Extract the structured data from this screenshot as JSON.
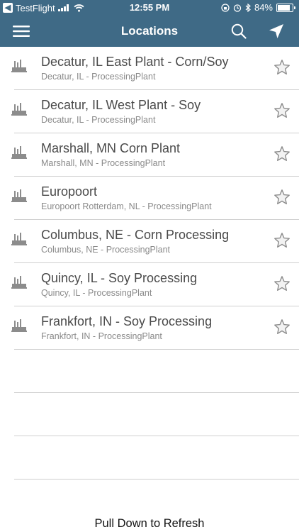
{
  "status_bar": {
    "carrier": "TestFlight",
    "time": "12:55 PM",
    "battery": "84%"
  },
  "nav": {
    "title": "Locations",
    "menu_icon": "hamburger-menu-icon",
    "search_icon": "search-icon",
    "location_icon": "location-arrow-icon"
  },
  "locations": [
    {
      "name": "Decatur, IL East Plant - Corn/Soy",
      "subtitle": "Decatur, IL - ProcessingPlant"
    },
    {
      "name": "Decatur, IL West Plant - Soy",
      "subtitle": "Decatur, IL - ProcessingPlant"
    },
    {
      "name": "Marshall, MN Corn Plant",
      "subtitle": "Marshall, MN - ProcessingPlant"
    },
    {
      "name": "Europoort",
      "subtitle": "Europoort Rotterdam, NL - ProcessingPlant"
    },
    {
      "name": "Columbus, NE - Corn Processing",
      "subtitle": "Columbus, NE - ProcessingPlant"
    },
    {
      "name": "Quincy, IL - Soy Processing",
      "subtitle": "Quincy, IL - ProcessingPlant"
    },
    {
      "name": "Frankfort, IN - Soy Processing",
      "subtitle": "Frankfort, IN - ProcessingPlant"
    }
  ],
  "footer": {
    "refresh_hint": "Pull Down to Refresh"
  },
  "colors": {
    "header_bg": "#3f6a86",
    "icon_gray": "#8c8c8c",
    "divider": "#cfcfcf"
  }
}
